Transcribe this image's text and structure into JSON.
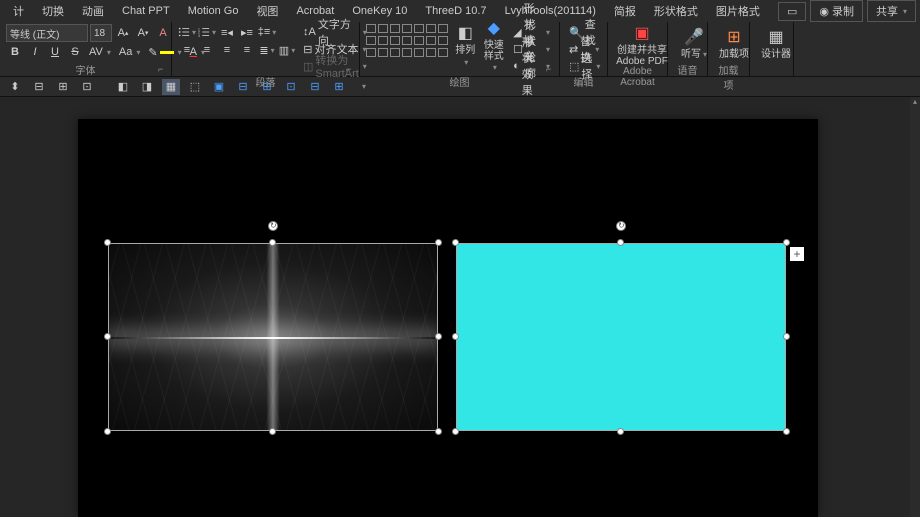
{
  "tabs": {
    "items": [
      "计",
      "切换",
      "动画",
      "Chat PPT",
      "Motion Go",
      "视图",
      "Acrobat",
      "OneKey 10",
      "ThreeD 10.7",
      "LvyhTools(201114)",
      "简报",
      "形状格式",
      "图片格式"
    ]
  },
  "titlebar": {
    "undo_icon": "↶",
    "record": "录制",
    "share": "共享"
  },
  "font_group": {
    "name_value": "等线 (正文)",
    "size_value": "18",
    "label": "字体",
    "bold": "B",
    "italic": "I",
    "underline": "U",
    "strike": "S",
    "spacing": "AV",
    "case": "Aa"
  },
  "para_group": {
    "label": "段落",
    "text_dir": "文字方向",
    "align_text": "对齐文本",
    "smartart": "转换为 SmartArt"
  },
  "draw_group": {
    "label": "绘图",
    "arrange": "排列",
    "quick": "快速样式",
    "fill": "形状填充",
    "outline": "形状轮廓",
    "effects": "形状效果"
  },
  "edit_group": {
    "label": "编辑",
    "find": "查找",
    "replace": "替换",
    "select": "选择"
  },
  "adobe_group": {
    "label": "Adobe Acrobat",
    "line1": "创建并共享",
    "line2": "Adobe PDF"
  },
  "voice_group": {
    "label": "语音",
    "dictate": "听写"
  },
  "addin_group": {
    "label": "加载项",
    "addins": "加载项"
  },
  "designer_group": {
    "designer": "设计器"
  },
  "colors": {
    "font_color": "#ff3333",
    "highlight": "#ffff00",
    "shape2_fill": "#33e6e6"
  },
  "canvas": {
    "plus": "+"
  }
}
